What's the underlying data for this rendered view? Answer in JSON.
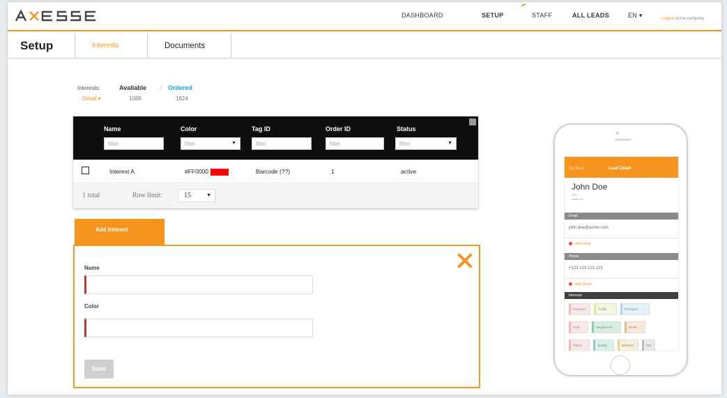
{
  "header": {
    "logo_text": "AXESS",
    "nav": {
      "dashboard": "DASHBOARD",
      "setup": "SETUP",
      "staff": "STAFF",
      "all_leads": "ALL LEADS",
      "language": "EN ▾"
    },
    "user": {
      "logout": "Logout",
      "company": "Acme company"
    },
    "accent": "#f7941d"
  },
  "subheader": {
    "title": "Setup",
    "tabs": [
      {
        "label": "Interests",
        "active": true
      },
      {
        "label": "Documents",
        "active": false
      }
    ]
  },
  "stats": {
    "label": "Interests:",
    "available_label": "Available",
    "separator": "/",
    "ordered_label": "Ordered",
    "detail_label": "Detail ▾",
    "available_count": "1088",
    "ordered_count": "1624",
    "ordered_color": "#1aa3e8"
  },
  "table": {
    "columns": [
      {
        "header": "Name",
        "filter_placeholder": "filter",
        "filter_type": "text"
      },
      {
        "header": "Color",
        "filter_placeholder": "filter",
        "filter_type": "select"
      },
      {
        "header": "Tag ID",
        "filter_placeholder": "filter",
        "filter_type": "text"
      },
      {
        "header": "Order ID",
        "filter_placeholder": "filter",
        "filter_type": "text"
      },
      {
        "header": "Status",
        "filter_placeholder": "filter",
        "filter_type": "select"
      }
    ],
    "rows": [
      {
        "name": "Interest A",
        "color": "#FF0000",
        "swatch": "#ff0000",
        "tag_id": "Barcode (??)",
        "order_id": "1",
        "status": "active"
      }
    ],
    "footer": {
      "total": "1 total",
      "row_limit_label": "Row limit:",
      "row_limit_value": "15"
    }
  },
  "add_interest": {
    "tab_label": "Add Interest",
    "name_label": "Name",
    "color_label": "Color",
    "save_label": "Save"
  },
  "phone": {
    "nav_back": "Go back",
    "nav_title": "Lead Detail",
    "contact_name": "John Doe",
    "contact_title": "CEO",
    "contact_company": "Acme Inc.",
    "email_section": "Email",
    "email": "john.doe@acme.com",
    "add_email": "Add email",
    "phone_section": "Phone",
    "phone_number": "+123 123 123 123",
    "add_phone": "Add phone",
    "interests_section": "Interests",
    "keywords": [
      [
        "Keyword",
        "Traffic",
        "Prototype"
      ],
      [
        "Audi",
        "Megatrends",
        "Email"
      ],
      [
        "Planck",
        "Quality",
        "Ethernet",
        "SW"
      ]
    ],
    "keyword_colors": [
      [
        "#f4b6b6",
        "#d8ea9a",
        "#a9d8f2"
      ],
      [
        "#f4b6b6",
        "#86d1a6",
        "#e8b98a"
      ],
      [
        "#f4b6b6",
        "#86d1c6",
        "#e8d28a",
        "#bbbbbb"
      ]
    ]
  }
}
